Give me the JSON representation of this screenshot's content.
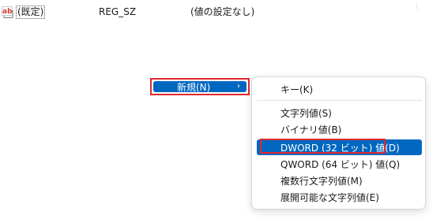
{
  "registry_row": {
    "icon": "string-value-icon",
    "icon_text": "ab",
    "name": "(既定)",
    "type": "REG_SZ",
    "data": "(値の設定なし)"
  },
  "context_menu": {
    "new_item": {
      "label": "新規(N)",
      "arrow": "›"
    },
    "submenu": {
      "items": [
        {
          "label": "キー(K)"
        },
        {
          "label": "文字列値(S)"
        },
        {
          "label": "バイナリ値(B)"
        },
        {
          "label": "DWORD (32 ビット) 値(D)"
        },
        {
          "label": "QWORD (64 ビット) 値(Q)"
        },
        {
          "label": "複数行文字列値(M)"
        },
        {
          "label": "展開可能な文字列値(E)"
        }
      ]
    }
  },
  "colors": {
    "highlight": "#0067c0",
    "annotation_frame": "#e0282e",
    "icon_red": "#d33b2c"
  }
}
